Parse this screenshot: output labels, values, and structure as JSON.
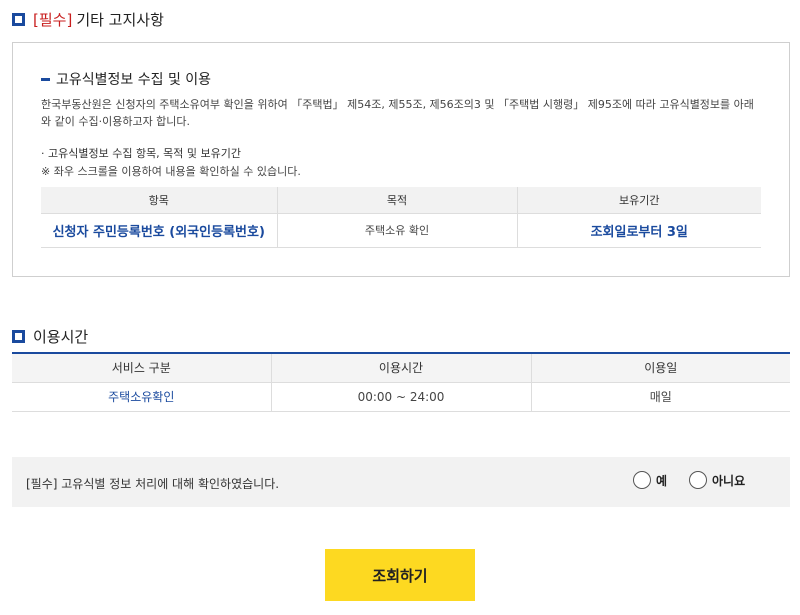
{
  "notice": {
    "required_tag": "[필수]",
    "title": "기타 고지사항",
    "subtitle": "고유식별정보 수집 및 이용",
    "description": "한국부동산원은 신청자의 주택소유여부 확인을 위하여 「주택법」 제54조, 제55조, 제56조의3 및 「주택법 시행령」 제95조에 따라 고유식별정보를 아래와 같이 수집·이용하고자 합니다.",
    "bullet": "· 고유식별정보 수집 항목, 목적 및 보유기간",
    "note": "※ 좌우 스크롤을 이용하여 내용을 확인하실 수 있습니다.",
    "table": {
      "headers": [
        "항목",
        "목적",
        "보유기간"
      ],
      "row": [
        "신청자 주민등록번호 (외국인등록번호)",
        "주택소유 확인",
        "조회일로부터 3일"
      ]
    }
  },
  "usage": {
    "title": "이용시간",
    "headers": [
      "서비스 구분",
      "이용시간",
      "이용일"
    ],
    "row": [
      "주택소유확인",
      "00:00 ~ 24:00",
      "매일"
    ]
  },
  "consent": {
    "label": "[필수] 고유식별 정보 처리에 대해 확인하였습니다.",
    "yes": "예",
    "no": "아니요"
  },
  "submit_label": "조회하기",
  "colors": {
    "accent": "#1a4a9e",
    "required": "#c81e1e",
    "button": "#fdd921"
  }
}
